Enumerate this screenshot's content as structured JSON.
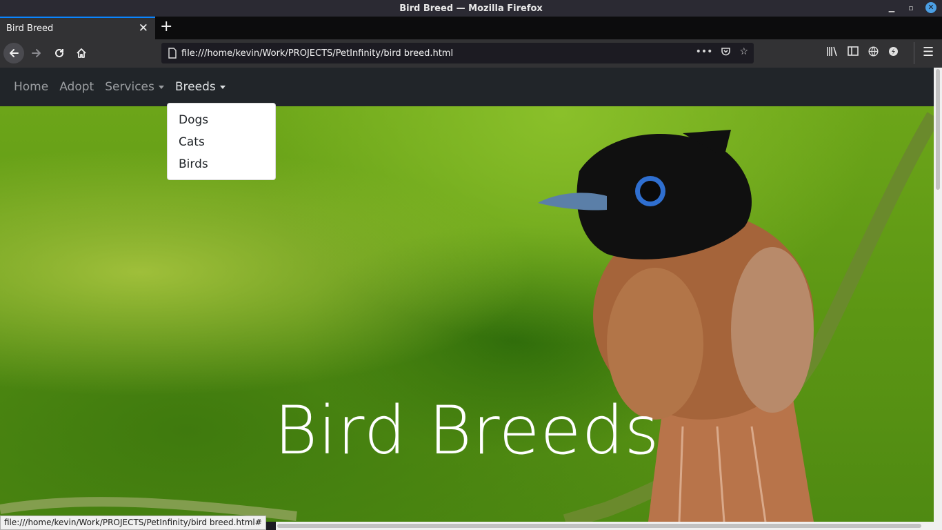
{
  "window": {
    "title": "Bird Breed — Mozilla Firefox",
    "minimize_icon": "minimize-icon",
    "maximize_icon": "restore-icon",
    "close_icon": "close-icon"
  },
  "tabs": [
    {
      "label": "Bird Breed",
      "close": "✕"
    }
  ],
  "toolbar": {
    "url": "file:///home/kevin/Work/PROJECTS/PetInfinity/bird breed.html",
    "back_icon": "back-arrow-icon",
    "forward_icon": "forward-arrow-icon",
    "reload_icon": "reload-icon",
    "home_icon": "home-icon"
  },
  "navbar": {
    "items": [
      {
        "label": "Home"
      },
      {
        "label": "Adopt"
      },
      {
        "label": "Services"
      },
      {
        "label": "Breeds"
      }
    ]
  },
  "dropdown": {
    "items": [
      "Dogs",
      "Cats",
      "Birds"
    ]
  },
  "hero": {
    "title": "Bird Breeds"
  },
  "statusbar": {
    "text": "file:///home/kevin/Work/PROJECTS/PetInfinity/bird breed.html#"
  },
  "colors": {
    "accent": "#0a84ff",
    "navbar_bg": "#212529",
    "hero_green": "#6ea21c"
  }
}
